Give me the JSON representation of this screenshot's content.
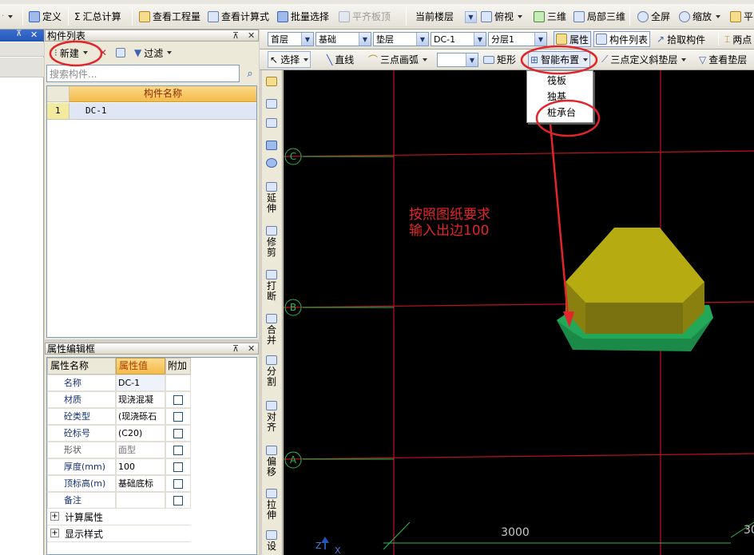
{
  "toolbar1": {
    "define": "定义",
    "summary": "汇总计算",
    "quantities": "查看工程量",
    "formula": "查看计算式",
    "batch": "批量选择",
    "flush_slab": "平齐板顶",
    "current_floor": "当前楼层",
    "top_view": "俯视",
    "three_d": "三维",
    "local_3d": "局部三维",
    "fullscreen": "全屏",
    "zoom": "缩放",
    "pan": "平",
    "sigma": "Σ"
  },
  "left_tree": {
    "close": "✕",
    "pin": "⊼"
  },
  "component_list": {
    "title": "构件列表",
    "new_button": "新建",
    "filter_button": "过滤",
    "search_placeholder": "搜索构件...",
    "col_name": "构件名称",
    "rows": [
      {
        "num": "1",
        "name": "DC-1"
      }
    ]
  },
  "properties": {
    "title": "属性编辑框",
    "headers": {
      "name": "属性名称",
      "value": "属性值",
      "extra": "附加"
    },
    "rows": [
      {
        "name": "名称",
        "value": "DC-1",
        "checkbox": false
      },
      {
        "name": "材质",
        "value": "现浇混凝",
        "checkbox": true
      },
      {
        "name": "砼类型",
        "value": "(现浇砾石",
        "checkbox": true
      },
      {
        "name": "砼标号",
        "value": "(C20)",
        "checkbox": true
      },
      {
        "name": "形状",
        "value": "面型",
        "checkbox": true
      },
      {
        "name": "厚度(mm)",
        "value": "100",
        "checkbox": true
      },
      {
        "name": "顶标高(m)",
        "value": "基础底标",
        "checkbox": true
      },
      {
        "name": "备注",
        "value": "",
        "checkbox": true
      }
    ],
    "groups": [
      {
        "expander": "+",
        "label": "计算属性"
      },
      {
        "expander": "+",
        "label": "显示样式"
      }
    ]
  },
  "toolbar2": {
    "floor": "首层",
    "category": "基础",
    "type": "垫层",
    "component": "DC-1",
    "layer": "分层1",
    "properties": "属性",
    "component_list": "构件列表",
    "pick": "拾取构件",
    "two_point": "两点"
  },
  "toolbar3": {
    "select": "选择",
    "line": "直线",
    "arc3": "三点画弧",
    "blank_combo": "",
    "rect": "矩形",
    "smart_place": "智能布置",
    "slope3": "三点定义斜垫层",
    "view_layer": "查看垫层"
  },
  "smart_menu": {
    "items": [
      "筏板",
      "独基",
      "桩承台"
    ]
  },
  "vertical_tools": [
    {
      "id": "extend",
      "label": "延伸"
    },
    {
      "id": "trim",
      "label": "修剪"
    },
    {
      "id": "break",
      "label": "打断"
    },
    {
      "id": "merge",
      "label": "合并"
    },
    {
      "id": "split",
      "label": "分割"
    },
    {
      "id": "align",
      "label": "对齐"
    },
    {
      "id": "offset",
      "label": "偏移"
    },
    {
      "id": "stretch",
      "label": "拉伸"
    },
    {
      "id": "set",
      "label": "设"
    }
  ],
  "canvas": {
    "annotation_line1": "按照图纸要求",
    "annotation_line2": "输入出边100",
    "axis_labels": [
      "C",
      "B",
      "A"
    ],
    "dim_3000": "3000",
    "dim_3000_b": "30",
    "ucs_z": "Z",
    "ucs_x": "X"
  },
  "colors": {
    "canvas_bg": "#000000",
    "grid_red": "#c0121e",
    "axis_green": "#2fb84a",
    "annotation_red": "#e2252a",
    "pile_cap_top": "#b7ab12",
    "pile_cap_side": "#8a8010",
    "cushion_green": "#1f9e55",
    "highlight_blue": "#316ac5",
    "header_orange": "#f6c766"
  }
}
